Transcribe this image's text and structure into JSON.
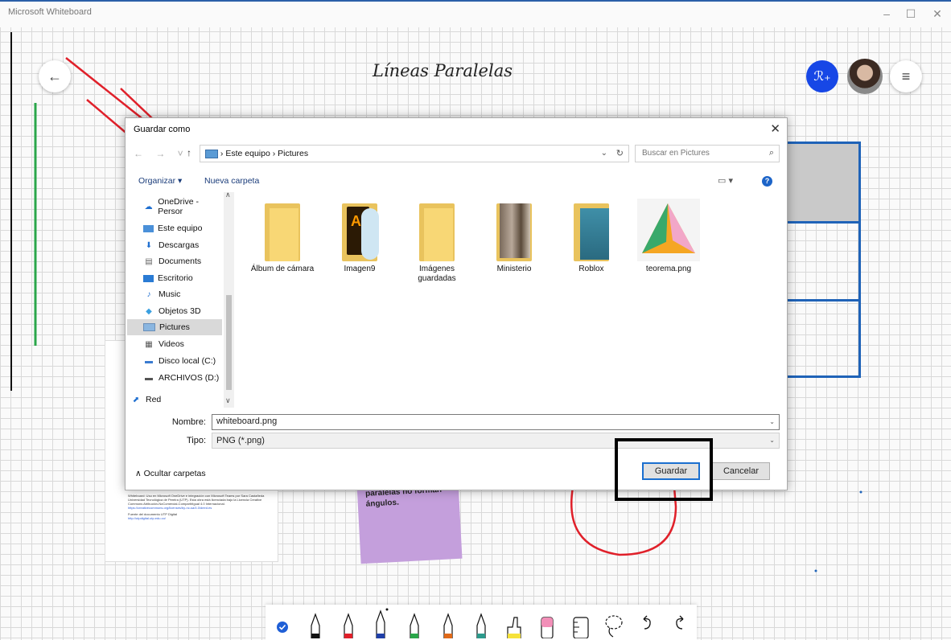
{
  "window": {
    "app_title": "Microsoft Whiteboard",
    "minimize": "–",
    "maximize": "☐",
    "close": "✕"
  },
  "board": {
    "title": "Líneas Paralelas",
    "back_icon": "←",
    "share_icon": "ℛ₊",
    "menu_icon": "≡",
    "sticky_text": "paralelas no forman ángulos.",
    "card_small_text": "Whiteboard: Uso en Microsoft OneDrive e integración con Microsoft Teams por Sara Castañeda Universidad Tecnológica de Pereira (UTP). Esta obra está licenciada bajo la Licencia Creative Commons Atribución-NoComercial-CompartirIgual 4.0 Internacional.",
    "card_link_text": "https://creativecommons.org/licenses/by-nc-sa/4.0/deed.es",
    "card_footer": "Fuente del documento UTP Digital",
    "card_footer_link": "http://utpdigital.utp.edu.co/"
  },
  "dialog": {
    "title": "Guardar como",
    "close": "✕",
    "path": [
      "Este equipo",
      "Pictures"
    ],
    "search_placeholder": "Buscar en Pictures",
    "organize": "Organizar ▾",
    "new_folder": "Nueva carpeta",
    "help": "?",
    "nav_items": [
      {
        "label": "OneDrive - Persor",
        "icon": "cloud-icon"
      },
      {
        "label": "Este equipo",
        "icon": "computer-icon"
      },
      {
        "label": "Descargas",
        "icon": "download-icon"
      },
      {
        "label": "Documents",
        "icon": "document-icon"
      },
      {
        "label": "Escritorio",
        "icon": "desktop-icon"
      },
      {
        "label": "Music",
        "icon": "music-icon"
      },
      {
        "label": "Objetos 3D",
        "icon": "cube-icon"
      },
      {
        "label": "Pictures",
        "icon": "pictures-icon"
      },
      {
        "label": "Videos",
        "icon": "video-icon"
      },
      {
        "label": "Disco local (C:)",
        "icon": "disk-icon"
      },
      {
        "label": "ARCHIVOS (D:)",
        "icon": "drive-icon"
      },
      {
        "label": "Red",
        "icon": "network-icon"
      }
    ],
    "files": [
      {
        "label": "Álbum de cámara",
        "kind": "folder"
      },
      {
        "label": "Imagen9",
        "kind": "ai-folder"
      },
      {
        "label": "Imágenes guardadas",
        "kind": "folder"
      },
      {
        "label": "Ministerio",
        "kind": "photo-folder"
      },
      {
        "label": "Roblox",
        "kind": "roblox-folder"
      },
      {
        "label": "teorema.png",
        "kind": "image"
      }
    ],
    "name_label": "Nombre:",
    "name_value": "whiteboard.png",
    "type_label": "Tipo:",
    "type_value": "PNG (*.png)",
    "hide_folders": "∧  Ocultar carpetas",
    "save": "Guardar",
    "cancel": "Cancelar"
  },
  "toolbar": {
    "tools": [
      "check-icon",
      "pen-black",
      "pen-red",
      "pen-blue",
      "pen-green",
      "pen-orange",
      "pen-teal",
      "highlighter-yellow",
      "eraser-pink",
      "ruler-icon",
      "lasso-icon",
      "undo-icon",
      "redo-icon"
    ],
    "colors": {
      "black": "#111111",
      "red": "#e0202a",
      "blue": "#1f3fa8",
      "green": "#2aa64a",
      "orange": "#e06a1a",
      "teal": "#2c9a8c",
      "yellow": "#f6e23a",
      "pink": "#f28fb8"
    }
  }
}
